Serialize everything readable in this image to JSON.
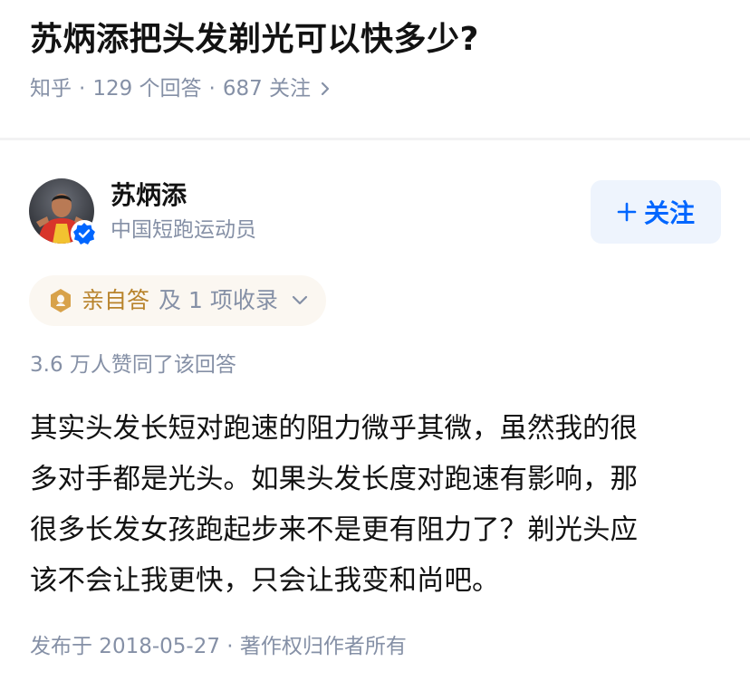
{
  "question": {
    "title": "苏炳添把头发剃光可以快多少?",
    "source": "知乎",
    "answers": "129 个回答",
    "followers": "687 关注",
    "separator": "·"
  },
  "author": {
    "name": "苏炳添",
    "headline": "中国短跑运动员",
    "follow_label": "关注"
  },
  "badge": {
    "label": "亲自答",
    "extra": "及 1 项收录"
  },
  "votes": "3.6 万人赞同了该回答",
  "content": {
    "lines": [
      "其实头发长短对跑速的阻力微乎其微，虽然我的很",
      "多对手都是光头。如果头发长度对跑速有影响，那",
      "很多长发女孩跑起步来不是更有阻力了？剃光头应",
      "该不会让我更快，只会让我变和尚吧。"
    ]
  },
  "footer": "发布于 2018-05-27 · 著作权归作者所有",
  "colors": {
    "accent": "#0066ff",
    "meta": "#8590a6",
    "gold": "#b8832b"
  }
}
